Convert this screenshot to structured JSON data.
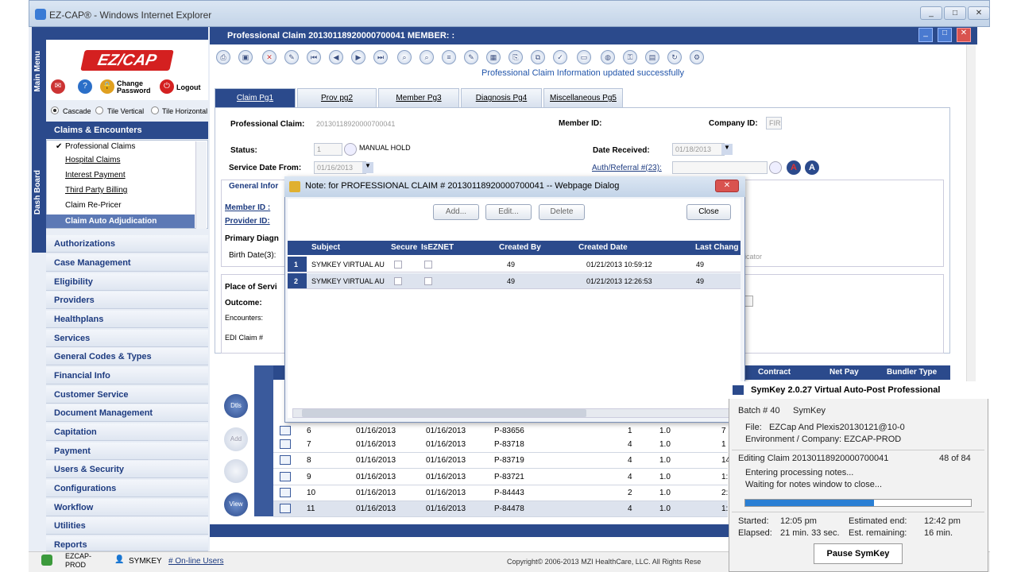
{
  "window": {
    "title": "EZ-CAP® - Windows Internet Explorer",
    "controls": [
      "_",
      "□",
      "✕"
    ]
  },
  "side_tabs": {
    "main_menu": "Main Menu",
    "dashboard": "Dash Board"
  },
  "logo": "EZ/CAP",
  "top_actions": {
    "change_password": "Change Password",
    "logout": "Logout"
  },
  "window_mode": {
    "cascade": "Cascade",
    "tile_vertical": "Tile Vertical",
    "tile_horizontal": "Tile Horizontal"
  },
  "nav": {
    "section_title": "Claims & Encounters",
    "subitems": [
      "Professional Claims",
      "Hospital Claims",
      "Interest Payment",
      "Third Party Billing",
      "Claim Re-Pricer"
    ],
    "selected_subitem": "Claim Auto Adjudication",
    "items": [
      "Authorizations",
      "Case Management",
      "Eligibility",
      "Providers",
      "Healthplans",
      "Services",
      "General Codes & Types",
      "Financial Info",
      "Customer Service",
      "Document Management",
      "Capitation",
      "Payment",
      "Users & Security",
      "Configurations",
      "Workflow",
      "Utilities",
      "Reports"
    ]
  },
  "main": {
    "header": "Professional Claim 20130118920000700041 MEMBER: :",
    "status_message": "Professional Claim Information updated successfully",
    "tabs": [
      "Claim Pg1",
      "Prov pg2",
      "Member Pg3",
      "Diagnosis Pg4",
      "Miscellaneous Pg5"
    ],
    "professional_claim_label": "Professional Claim:",
    "professional_claim_value": "20130118920000700041",
    "member_id_label": "Member ID:",
    "company_id_label": "Company ID:",
    "company_id_value": "FIR",
    "status_label": "Status:",
    "status_value": "1",
    "status_text": "MANUAL HOLD",
    "date_received_label": "Date Received:",
    "date_received_value": "01/18/2013",
    "service_date_label": "Service Date From:",
    "service_date_value": "01/16/2013",
    "auth_label": "Auth/Referral #(23):",
    "general_info": "General Infor",
    "member_id_link": "Member ID :",
    "provider_id_link": "Provider ID:",
    "primary_diag": "Primary Diagn",
    "birth_date": "Birth Date(3):",
    "place_of_service": "Place of Servi",
    "outcome": "Outcome:",
    "encounters": "Encounters:",
    "edi_claim": "EDI Claim #",
    "indicator_text": "dicator"
  },
  "grid": {
    "headers": [
      "Contract",
      "Net Pay",
      "Bundler Type"
    ],
    "rows": [
      {
        "n": "6",
        "from": "01/16/2013",
        "to": "01/16/2013",
        "proc": "P-83656",
        "qty": "1",
        "unit": "1.0",
        "tail": "7"
      },
      {
        "n": "7",
        "from": "01/16/2013",
        "to": "01/16/2013",
        "proc": "P-83718",
        "qty": "4",
        "unit": "1.0",
        "tail": "1"
      },
      {
        "n": "8",
        "from": "01/16/2013",
        "to": "01/16/2013",
        "proc": "P-83719",
        "qty": "4",
        "unit": "1.0",
        "tail": "14"
      },
      {
        "n": "9",
        "from": "01/16/2013",
        "to": "01/16/2013",
        "proc": "P-83721",
        "qty": "4",
        "unit": "1.0",
        "tail": "1:"
      },
      {
        "n": "10",
        "from": "01/16/2013",
        "to": "01/16/2013",
        "proc": "P-84443",
        "qty": "2",
        "unit": "1.0",
        "tail": "2:"
      },
      {
        "n": "11",
        "from": "01/16/2013",
        "to": "01/16/2013",
        "proc": "P-84478",
        "qty": "4",
        "unit": "1.0",
        "tail": "1:"
      }
    ],
    "side_buttons": [
      "Dtls",
      "Add",
      "",
      "View"
    ]
  },
  "dialog": {
    "title": "Note: for PROFESSIONAL CLAIM # 20130118920000700041 -- Webpage Dialog",
    "buttons": [
      "Add...",
      "Edit...",
      "Delete",
      "Close"
    ],
    "columns": [
      "Subject",
      "Secure",
      "IsEZNET",
      "Created By",
      "Created Date",
      "Last Chang"
    ],
    "rows": [
      {
        "n": "1",
        "subject": "SYMKEY VIRTUAL AU",
        "created_by": "49",
        "created_date": "01/21/2013 10:59:12",
        "last": "49"
      },
      {
        "n": "2",
        "subject": "SYMKEY VIRTUAL AU",
        "created_by": "49",
        "created_date": "01/21/2013 12:26:53",
        "last": "49"
      }
    ]
  },
  "symkey": {
    "title": "SymKey 2.0.27  Virtual Auto-Post Professional",
    "batch": "Batch # 40",
    "batch_user": "SymKey",
    "file": "File:   EZCap And Plexis20130121@10-0",
    "env": "Environment / Company:  EZCAP-PROD",
    "editing": "Editing Claim 20130118920000700041",
    "count": "48 of 84",
    "step1": "Entering processing notes...",
    "step2": "Waiting for notes window to close...",
    "progress": 0.57,
    "started_label": "Started:",
    "started": "12:05 pm",
    "elapsed_label": "Elapsed:",
    "elapsed": "21 min. 33 sec.",
    "est_end_label": "Estimated end:",
    "est_end": "12:42 pm",
    "est_rem_label": "Est. remaining:",
    "est_rem": "16 min.",
    "pause": "Pause SymKey"
  },
  "footer": {
    "env": "EZCAP-PROD",
    "user": "SYMKEY",
    "online_users": "# On-line Users",
    "copyright": "Copyright© 2006-2013 MZI HealthCare, LLC. All Rights Rese"
  },
  "colors": {
    "nav_blue": "#2b4a8c",
    "logo_red": "#d42020",
    "progress_blue": "#2a7fd4"
  }
}
